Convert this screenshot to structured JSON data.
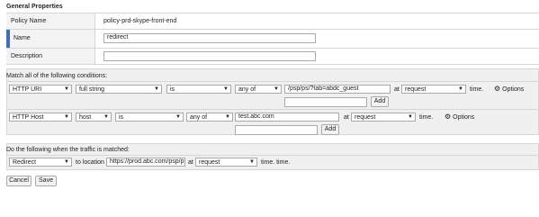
{
  "general": {
    "title": "General Properties",
    "policy_name_label": "Policy Name",
    "policy_name_value": "policy-prd-skype-front-end",
    "name_label": "Name",
    "name_value": "redirect",
    "description_label": "Description",
    "description_value": ""
  },
  "conditions": {
    "title": "Match all of the following conditions:",
    "rows": [
      {
        "type": "HTTP URI",
        "selector": "full string",
        "operand": "is",
        "match": "any of",
        "value": "/psp/ps/?tab=abdc_guest",
        "at_label": "at",
        "at_value": "request",
        "time_label": "time.",
        "options_label": "Options",
        "add_label": "Add"
      },
      {
        "type": "HTTP Host",
        "selector": "host",
        "operand": "is",
        "match": "any of",
        "value": "test.abc.com",
        "at_label": "at",
        "at_value": "request",
        "time_label": "time.",
        "options_label": "Options",
        "add_label": "Add"
      }
    ]
  },
  "actions": {
    "title": "Do the following when the traffic is matched:",
    "action": "Redirect",
    "to_location_label": "to location",
    "location_value": "https://prod.abc.com/psp/p",
    "at_label": "at",
    "at_value": "request",
    "time_label": "time. time."
  },
  "buttons": {
    "cancel": "Cancel",
    "save": "Save"
  },
  "icons": {
    "options": "gear-icon",
    "dropdown": "chevron-down-icon"
  },
  "colors": {
    "active_row_marker": "#3b6fb6",
    "label_cell_bg": "#f3f3f3",
    "section_bg": "#f0f0f0",
    "border": "#d6d6d6"
  }
}
